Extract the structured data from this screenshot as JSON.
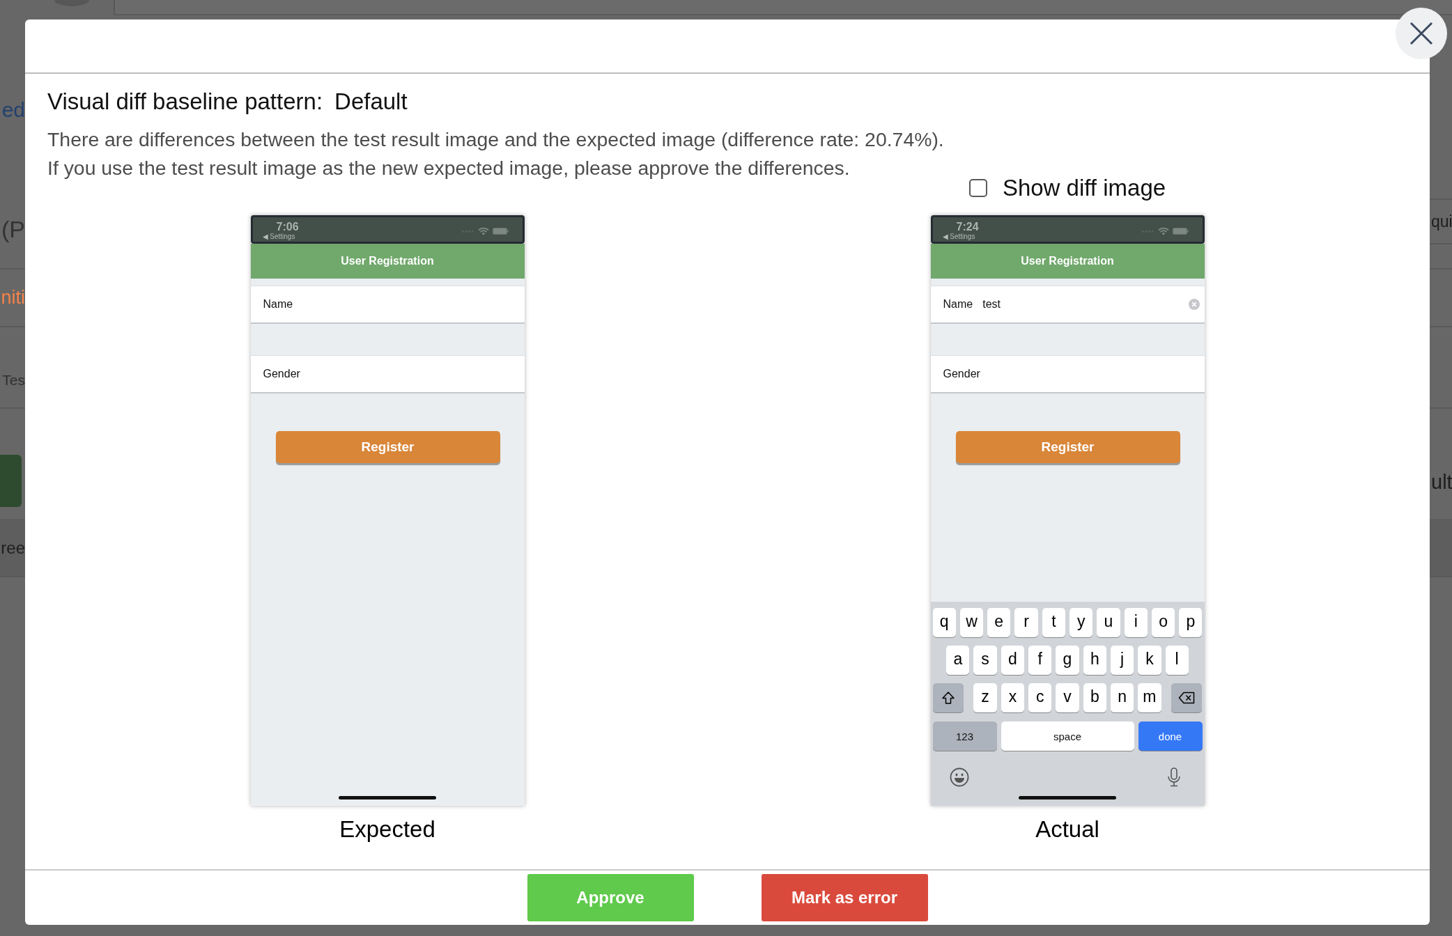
{
  "background_page": {
    "rows": [
      {
        "left": {
          "kind": "link",
          "text": "ed"
        }
      },
      {
        "left": {
          "kind": "heading",
          "text": "(P"
        },
        "right": {
          "kind": "text",
          "text": "qui"
        }
      },
      {
        "left": {
          "kind": "status",
          "text": "niti"
        }
      },
      {
        "left": {
          "kind": "muted",
          "text": "Tes"
        }
      },
      {
        "left": {
          "kind": "button"
        },
        "right": {
          "kind": "text",
          "text": "ult"
        }
      },
      {
        "left": {
          "kind": "text",
          "text": "ree"
        }
      }
    ]
  },
  "dialog": {
    "title_label": "Visual diff baseline pattern:",
    "title_value": "Default",
    "messages": [
      "There are differences between the test result image and the expected image (difference rate: 20.74%).",
      "If you use the test result image as the new expected image, please approve the differences."
    ],
    "show_diff_image": {
      "label": "Show diff image",
      "checked": false
    },
    "screenshots": [
      {
        "caption": "Expected",
        "status_time": "7:06",
        "back_label": "◀ Settings",
        "title": "User Registration",
        "fields": [
          {
            "label": "Name",
            "clear_button": false
          },
          {
            "label": "Gender",
            "clear_button": false
          }
        ],
        "button": "Register"
      },
      {
        "caption": "Actual",
        "status_time": "7:24",
        "back_label": "◀ Settings",
        "title": "User Registration",
        "fields": [
          {
            "label": "Name",
            "value": "test",
            "clear_button": true
          },
          {
            "label": "Gender",
            "clear_button": false
          }
        ],
        "button": "Register",
        "keyboard": {
          "letter_rows": [
            [
              "q",
              "w",
              "e",
              "r",
              "t",
              "y",
              "u",
              "i",
              "o",
              "p"
            ],
            [
              "a",
              "s",
              "d",
              "f",
              "g",
              "h",
              "j",
              "k",
              "l"
            ],
            [
              "z",
              "x",
              "c",
              "v",
              "b",
              "n",
              "m"
            ]
          ],
          "number_key": "123",
          "space_key": "space",
          "return_key": "done"
        }
      }
    ],
    "buttons": [
      {
        "kind": "approve",
        "label": "Approve"
      },
      {
        "kind": "error",
        "label": "Mark as error"
      }
    ]
  }
}
